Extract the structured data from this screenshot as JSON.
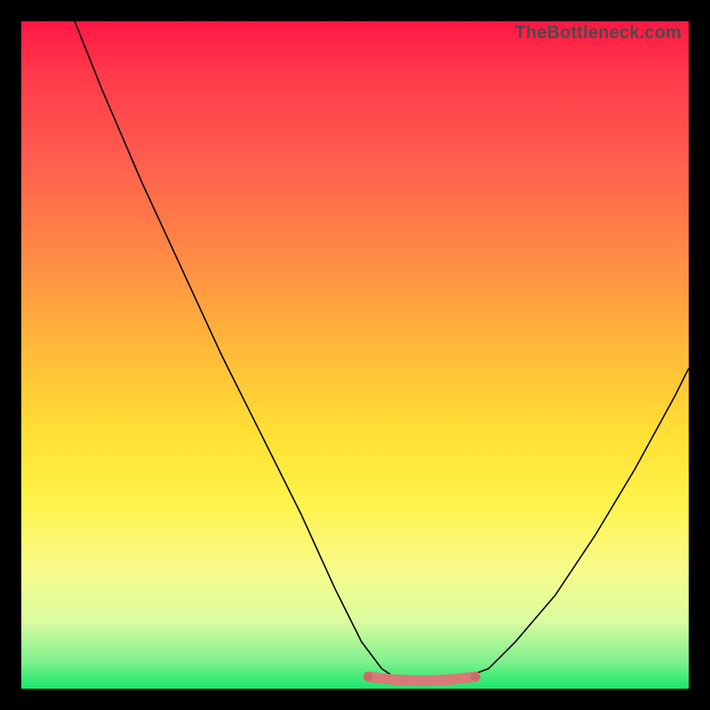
{
  "watermark": "TheBottleneck.com",
  "chart_data": {
    "type": "line",
    "title": "",
    "xlabel": "",
    "ylabel": "",
    "xlim": [
      0,
      100
    ],
    "ylim": [
      0,
      100
    ],
    "series": [
      {
        "name": "curve",
        "x": [
          8,
          12,
          18,
          24,
          30,
          36,
          42,
          47,
          51,
          54,
          57,
          62,
          66,
          70,
          74,
          80,
          86,
          92,
          98,
          100
        ],
        "values": [
          100,
          90,
          76,
          63,
          50,
          38,
          26,
          15,
          7,
          3,
          1,
          1,
          1.5,
          3,
          7,
          14,
          23,
          33,
          44,
          48
        ]
      }
    ],
    "highlight_band": {
      "x_start": 52,
      "x_end": 68,
      "y": 1
    },
    "background_gradient": [
      "#ff1744",
      "#ffe033",
      "#16e86b"
    ]
  }
}
